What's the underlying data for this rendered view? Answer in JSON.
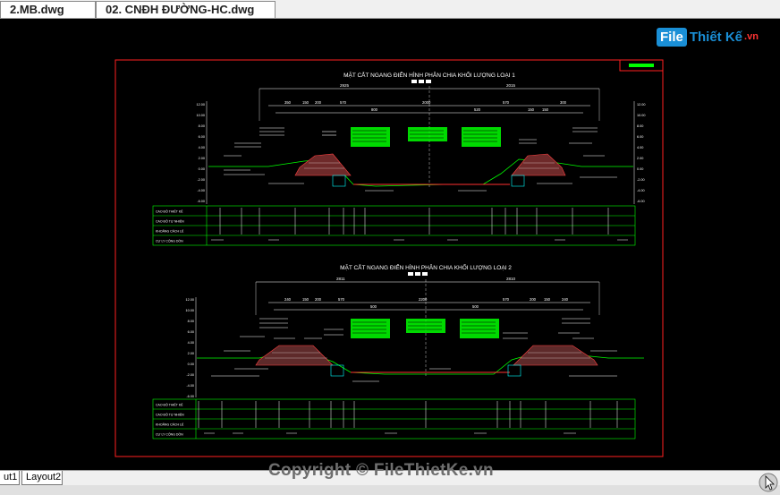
{
  "tabs": [
    {
      "label": "2.MB.dwg"
    },
    {
      "label": "02. CNĐH ĐƯỜNG-HC.dwg"
    }
  ],
  "logo": {
    "box": "File",
    "text": "Thiết Kế",
    "sub": ".vn"
  },
  "sections": [
    {
      "title": "MẶT CẮT NGANG ĐIỂN HÌNH PHÂN CHIA KHỐI LƯỢNG LOẠI 1",
      "left_dim": "2925",
      "right_dim": "2015",
      "dims": [
        "350",
        "150",
        "200",
        "570",
        "800",
        "2000",
        "520",
        "570",
        "150",
        "150",
        "300"
      ],
      "table_rows": [
        "CAO ĐỘ THIẾT KẾ",
        "CAO ĐỘ TỰ NHIÊN",
        "KHOẢNG CÁCH LẺ",
        "CỰ LY CỘNG DỒN"
      ],
      "left_ticks": [
        "12.00",
        "10.00",
        "8.00",
        "6.00",
        "4.00",
        "2.00",
        "0.00",
        "-2.00",
        "-4.00",
        "-6.00"
      ],
      "right_ticks": [
        "12.00",
        "10.00",
        "8.00",
        "6.00",
        "4.00",
        "2.00",
        "0.00",
        "-2.00",
        "-4.00",
        "-6.00"
      ]
    },
    {
      "title": "MẶT CẮT NGANG ĐIỂN HÌNH PHÂN CHIA KHỐI LƯỢNG LOẠI 2",
      "left_dim": "2811",
      "right_dim": "2810",
      "dims": [
        "240",
        "150",
        "200",
        "570",
        "500",
        "2200",
        "500",
        "570",
        "200",
        "150",
        "240"
      ],
      "table_rows": [
        "CAO ĐỘ THIẾT KẾ",
        "CAO ĐỘ TỰ NHIÊN",
        "KHOẢNG CÁCH LẺ",
        "CỰ LY CỘNG DỒN"
      ],
      "left_ticks": [
        "12.00",
        "10.00",
        "8.00",
        "6.00",
        "4.00",
        "2.00",
        "0.00",
        "-2.00",
        "-4.00",
        "-6.00"
      ],
      "right_ticks": []
    }
  ],
  "layout_tabs": [
    {
      "label": "ut1"
    },
    {
      "label": "Layout2"
    }
  ],
  "copyright": "Copyright © FileThietKe.vn"
}
